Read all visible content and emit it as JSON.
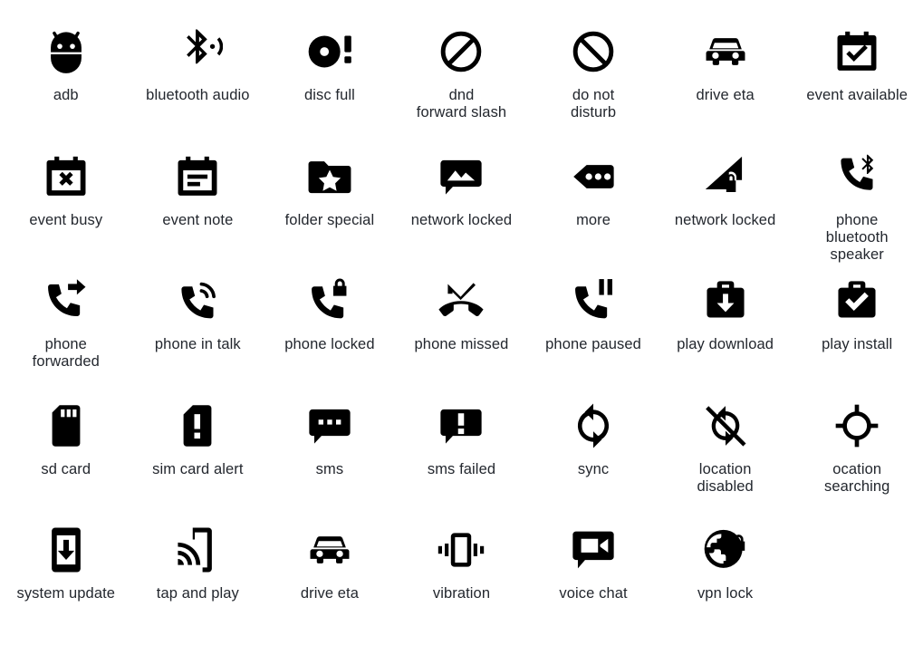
{
  "page": {
    "background": "#ffffff",
    "icon_color": "#000000",
    "label_color": "#23272e",
    "columns": 7,
    "rows": 5,
    "total_icons": 33
  },
  "icons": [
    {
      "name": "adb",
      "label": "adb",
      "glyph": "adb-icon"
    },
    {
      "name": "bluetooth-audio",
      "label": "bluetooth audio",
      "glyph": "bluetooth-audio-icon"
    },
    {
      "name": "disc-full",
      "label": "disc full",
      "glyph": "disc-full-icon"
    },
    {
      "name": "dnd-forward-slash",
      "label": "dnd\nforward slash",
      "glyph": "dnd-forward-slash-icon"
    },
    {
      "name": "do-not-disturb",
      "label": "do not\ndisturb",
      "glyph": "do-not-disturb-icon"
    },
    {
      "name": "drive-eta",
      "label": "drive eta",
      "glyph": "drive-eta-icon"
    },
    {
      "name": "event-available",
      "label": "event available",
      "glyph": "event-available-icon"
    },
    {
      "name": "event-busy",
      "label": "event busy",
      "glyph": "event-busy-icon"
    },
    {
      "name": "event-note",
      "label": "event note",
      "glyph": "event-note-icon"
    },
    {
      "name": "folder-special",
      "label": "folder special",
      "glyph": "folder-special-icon"
    },
    {
      "name": "network-locked-image",
      "label": "network locked",
      "glyph": "image-message-icon"
    },
    {
      "name": "more",
      "label": "more",
      "glyph": "more-icon"
    },
    {
      "name": "network-locked-signal",
      "label": "network locked",
      "glyph": "signal-lock-icon"
    },
    {
      "name": "phone-bluetooth-speaker",
      "label": "phone\nbluetooth\nspeaker",
      "glyph": "phone-bluetooth-speaker-icon"
    },
    {
      "name": "phone-forwarded",
      "label": "phone\nforwarded",
      "glyph": "phone-forwarded-icon"
    },
    {
      "name": "phone-in-talk",
      "label": "phone in talk",
      "glyph": "phone-in-talk-icon"
    },
    {
      "name": "phone-locked",
      "label": "phone locked",
      "glyph": "phone-locked-icon"
    },
    {
      "name": "phone-missed",
      "label": "phone missed",
      "glyph": "phone-missed-icon"
    },
    {
      "name": "phone-paused",
      "label": "phone paused",
      "glyph": "phone-paused-icon"
    },
    {
      "name": "play-download",
      "label": "play download",
      "glyph": "play-download-icon"
    },
    {
      "name": "play-install",
      "label": "play install",
      "glyph": "play-install-icon"
    },
    {
      "name": "sd-card",
      "label": "sd card",
      "glyph": "sd-card-icon"
    },
    {
      "name": "sim-card-alert",
      "label": "sim card alert",
      "glyph": "sim-card-alert-icon"
    },
    {
      "name": "sms",
      "label": "sms",
      "glyph": "sms-icon"
    },
    {
      "name": "sms-failed",
      "label": "sms failed",
      "glyph": "sms-failed-icon"
    },
    {
      "name": "sync",
      "label": "sync",
      "glyph": "sync-icon"
    },
    {
      "name": "location-disabled",
      "label": "location\ndisabled",
      "glyph": "location-disabled-icon"
    },
    {
      "name": "location-searching",
      "label": "ocation\nsearching",
      "glyph": "location-searching-icon"
    },
    {
      "name": "system-update",
      "label": "system update",
      "glyph": "system-update-icon"
    },
    {
      "name": "tap-and-play",
      "label": "tap and play",
      "glyph": "tap-and-play-icon"
    },
    {
      "name": "drive-eta-2",
      "label": "drive eta",
      "glyph": "drive-eta-icon"
    },
    {
      "name": "vibration",
      "label": "vibration",
      "glyph": "vibration-icon"
    },
    {
      "name": "voice-chat",
      "label": "voice chat",
      "glyph": "voice-chat-icon"
    },
    {
      "name": "vpn-lock",
      "label": "vpn lock",
      "glyph": "vpn-lock-icon"
    }
  ]
}
